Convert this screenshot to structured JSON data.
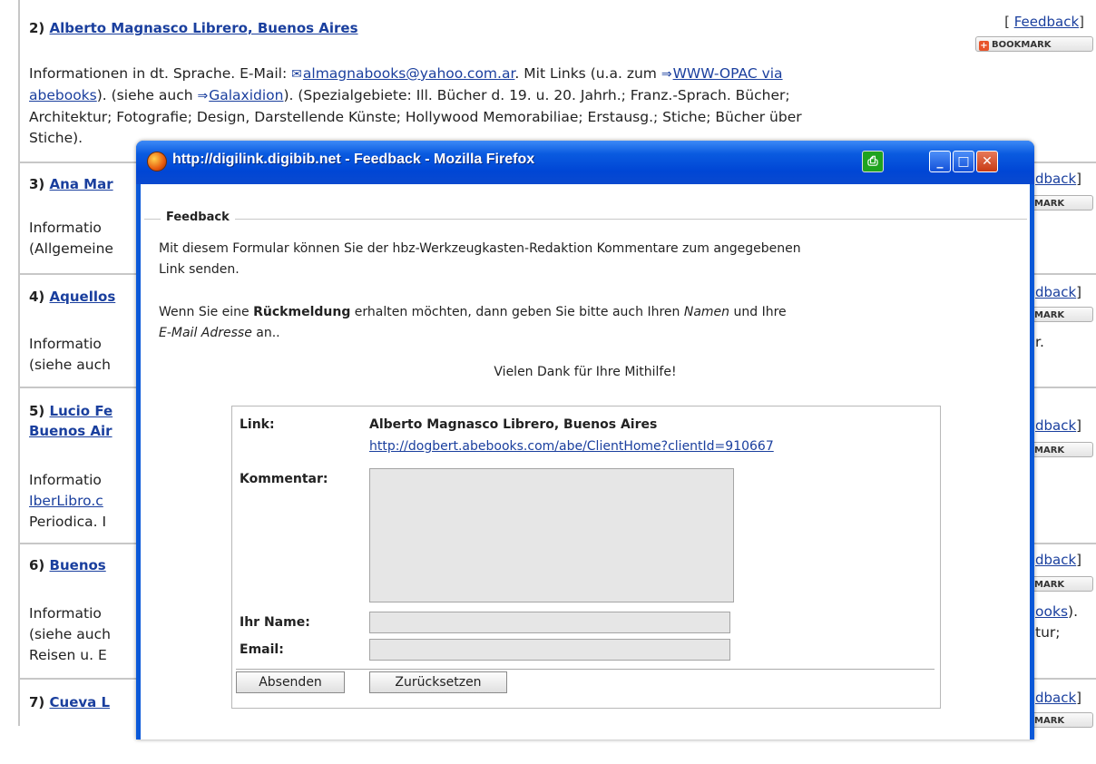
{
  "page": {
    "feedback_link": "Feedback",
    "bookmark_label": "BOOKMARK",
    "entries": [
      {
        "num": "2)",
        "title": "Alberto Magnasco Librero, Buenos Aires",
        "desc_line1_pre": "Informationen in dt. Sprache. E-Mail: ",
        "email": "almagnabooks@yahoo.com.ar",
        "desc_line1_mid": ". Mit Links (u.a. zum ",
        "opac_link_a": "WWW-OPAC via",
        "opac_link_b": "abebooks",
        "desc_line2_mid": "). (siehe auch ",
        "galax_link": "Galaxidion",
        "desc_line2_post": "). (Spezialgebiete: Ill. Bücher d. 19. u. 20. Jahrh.; Franz.-Sprach. Bücher;",
        "desc_line3": "Architektur; Fotografie; Design, Darstellende Künste; Hollywood Memorabiliae; Erstausg.; Stiche; Bücher über",
        "desc_line4": "Stiche)."
      },
      {
        "num": "3)",
        "title": "Ana Mar",
        "d1": "Informatio",
        "d2": "(Allgemeine"
      },
      {
        "num": "4)",
        "title": "Aquellos",
        "d1": "Informatio",
        "d2": "(siehe auch",
        "d1_right": "r."
      },
      {
        "num": "5)",
        "title": "Lucio Fe",
        "title2": "Buenos Air",
        "d1": "Informatio",
        "d2": "IberLibro.c",
        "d3": "Periodica. I"
      },
      {
        "num": "6)",
        "title": "Buenos",
        "d1": "Informatio",
        "d2": "(siehe auch",
        "d3": "Reisen u. E",
        "d1_right": "ooks",
        "d1_right_post": ").",
        "d2_right": "tur;"
      },
      {
        "num": "7)",
        "title": "Cueva L"
      }
    ],
    "right_fragments": {
      "feedback_partial": "dback",
      "bookmark_partial": "MARK"
    }
  },
  "popup": {
    "title": "http://digilink.digibib.net - Feedback - Mozilla Firefox",
    "legend": "Feedback",
    "para1": "Mit diesem Formular können Sie der hbz-Werkzeugkasten-Redaktion Kommentare zum angegebenen",
    "para1b": "Link senden.",
    "para2_pre": "Wenn Sie eine ",
    "para2_bold": "Rückmeldung",
    "para2_mid": " erhalten möchten, dann geben Sie bitte auch Ihren ",
    "para2_it1": "Namen",
    "para2_post": " und Ihre",
    "para2b_it": "E-Mail Adresse",
    "para2b_post": " an..",
    "thanks": "Vielen Dank für Ihre Mithilfe!",
    "form": {
      "link_label": "Link:",
      "link_title": "Alberto Magnasco Librero, Buenos Aires",
      "link_url": "http://dogbert.abebooks.com/abe/ClientHome?clientId=910667",
      "comment_label": "Kommentar:",
      "name_label": "Ihr Name:",
      "email_label": "Email:",
      "submit": "Absenden",
      "reset": "Zurücksetzen"
    }
  },
  "colors": {
    "link": "#1a3f9e",
    "titlebar": "#0a58d8"
  }
}
